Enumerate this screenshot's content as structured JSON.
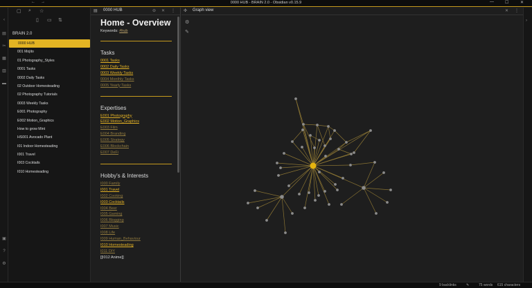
{
  "window": {
    "title": "0000 HUB - BRAIN 2.0 - Obsidian v0.15.9",
    "back_icon": "←",
    "forward_icon": "→",
    "minimize_icon": "—",
    "maximize_icon": "☐",
    "close_icon": "✕"
  },
  "ribbon": {
    "icons": [
      "‹",
      "▤",
      "✂",
      "▦",
      "▥",
      "▬",
      "▣",
      "?",
      "⚙"
    ]
  },
  "explorer": {
    "toolbar": {
      "files_icon": "▢",
      "search_icon": "⌕",
      "star_icon": "☆"
    },
    "actions": {
      "new_note": "▯",
      "new_folder": "▭",
      "sort": "⇅"
    },
    "vault_name": "BRAIN 2.0",
    "files": [
      "0000 HUB",
      "001 Mojito",
      "01 Photography_Styles",
      "0001 Tasks",
      "0002 Daily Tasks",
      "02 Outdoor Homesteading",
      "02 Photography Tutorials",
      "0003 Weekly Tasks",
      "E001 Photography",
      "E002 Motion_Graphics",
      "How to grow Mint",
      "HS001 Avocado Plant",
      "I01 Indoor Homesteading",
      "I001 Travel",
      "I003 Cocktails",
      "I010 Homesteading"
    ],
    "active_index": 0
  },
  "note": {
    "tab_icon": "▤",
    "tab_title": "0000 HUB",
    "tab_controls": [
      "⊖",
      "✕",
      "⋮"
    ],
    "title": "Home - Overview",
    "keywords_label": "Keywords: ",
    "keywords_tag": "#hub",
    "sections": [
      {
        "heading": "Tasks",
        "links": [
          {
            "text": "0001 Tasks",
            "style": "bright"
          },
          {
            "text": "0002 Daily Tasks",
            "style": "bright"
          },
          {
            "text": "0003 Weekly Tasks",
            "style": "bright"
          },
          {
            "text": "0004 Monthly Tasks",
            "style": "dim"
          },
          {
            "text": "0005 Yearly Tasks",
            "style": "dim"
          }
        ]
      },
      {
        "heading": "Expertises",
        "links": [
          {
            "text": "E001 Photography",
            "style": "bright"
          },
          {
            "text": "E002 Motion_Graphics",
            "style": "bright"
          },
          {
            "text": "E003 Film",
            "style": "dim"
          },
          {
            "text": "E004 Branding",
            "style": "dim"
          },
          {
            "text": "E005 Strategy",
            "style": "dim"
          },
          {
            "text": "E006 Blockchain",
            "style": "dim"
          },
          {
            "text": "E007 DeFi",
            "style": "dim"
          }
        ]
      },
      {
        "heading": "Hobby's & Interests",
        "links": [
          {
            "text": "I000 Family",
            "style": "dim"
          },
          {
            "text": "I001 Travel",
            "style": "bright"
          },
          {
            "text": "I002 Cooking",
            "style": "dim"
          },
          {
            "text": "I003 Cocktails",
            "style": "bright"
          },
          {
            "text": "I004 Beer",
            "style": "dim"
          },
          {
            "text": "I005 Gaming",
            "style": "dim"
          },
          {
            "text": "I006 Blogging",
            "style": "dim"
          },
          {
            "text": "I007 Music",
            "style": "dim"
          },
          {
            "text": "I008 Life",
            "style": "dim"
          },
          {
            "text": "I009 Human_Behaviour",
            "style": "dim"
          },
          {
            "text": "I010 Homesteading",
            "style": "bright"
          },
          {
            "text": "I011 DIY",
            "style": "dim"
          },
          {
            "text": "[[I012 Anime]]",
            "style": "plain"
          }
        ]
      }
    ]
  },
  "graph": {
    "tab_icon": "✣",
    "tab_title": "Graph view",
    "tab_controls": [
      "✕",
      "⋮"
    ],
    "settings_icon": "⚙",
    "animate_icon": "✎",
    "colors": {
      "hub": "#e5b40f",
      "node": "#8c8c8c",
      "link": "#8a7433"
    }
  },
  "right_strip": {
    "collapse_icon": "›"
  },
  "status": {
    "backlinks": "9 backlinks",
    "edit_icon": "✎",
    "words": "75 words",
    "characters": "615 characters"
  }
}
